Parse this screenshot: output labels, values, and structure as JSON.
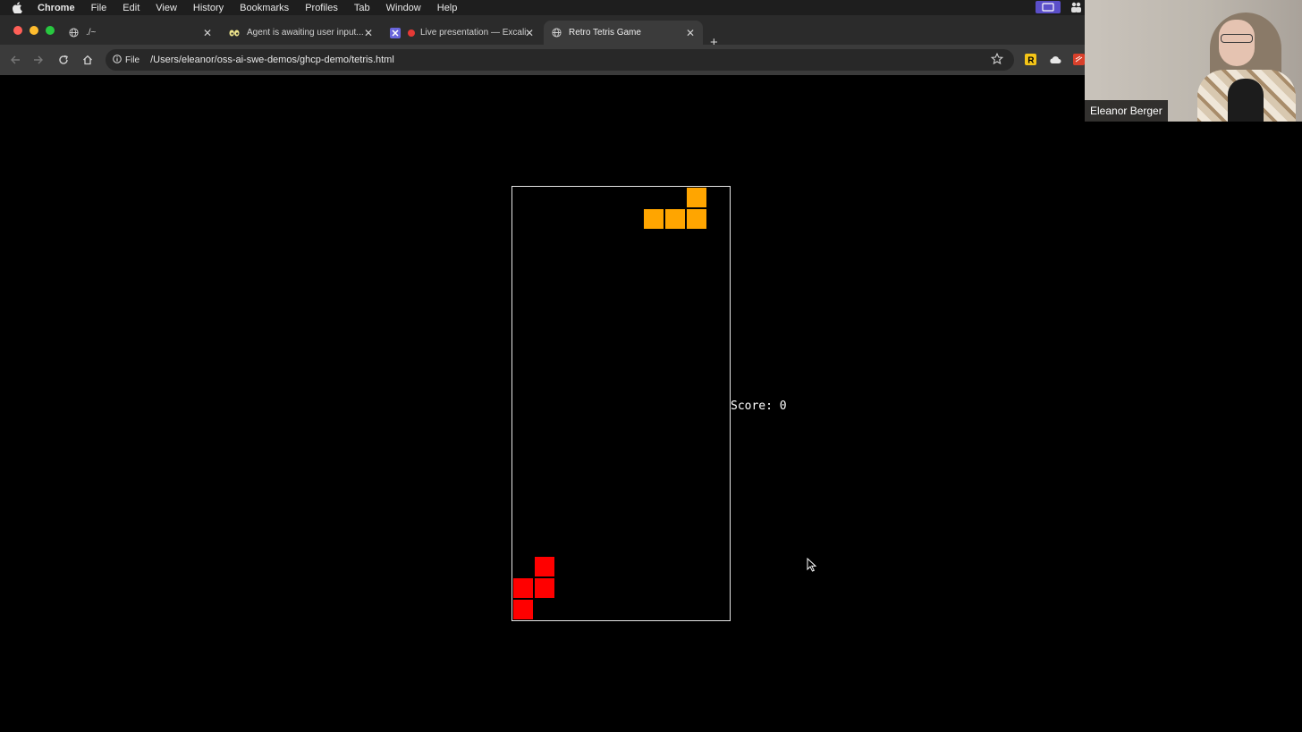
{
  "menubar": {
    "app_name": "Chrome",
    "items": [
      "File",
      "Edit",
      "View",
      "History",
      "Bookmarks",
      "Profiles",
      "Tab",
      "Window",
      "Help"
    ]
  },
  "tabs": [
    {
      "title": "./~",
      "icon": "globe-icon",
      "active": false
    },
    {
      "title": "Agent is awaiting user input...",
      "icon": "eyes-icon",
      "active": false
    },
    {
      "title": "Live presentation — Excali",
      "icon": "excalidraw-icon",
      "recording": true,
      "active": false
    },
    {
      "title": "Retro Tetris Game",
      "icon": "globe-icon",
      "active": true
    }
  ],
  "toolbar": {
    "scheme_chip": "File",
    "url": "/Users/eleanor/oss-ai-swe-demos/ghcp-demo/tetris.html"
  },
  "game": {
    "score_text": "Score: 0",
    "active_color": "#ffa500",
    "stacked_color": "#ff0000"
  },
  "webcam": {
    "participant_name": "Eleanor Berger"
  },
  "colors": {
    "menubar_bg": "#1e1e1e",
    "tabstrip_bg": "#2b2b2b",
    "toolbar_bg": "#3b3b3b",
    "page_bg": "#000000"
  }
}
